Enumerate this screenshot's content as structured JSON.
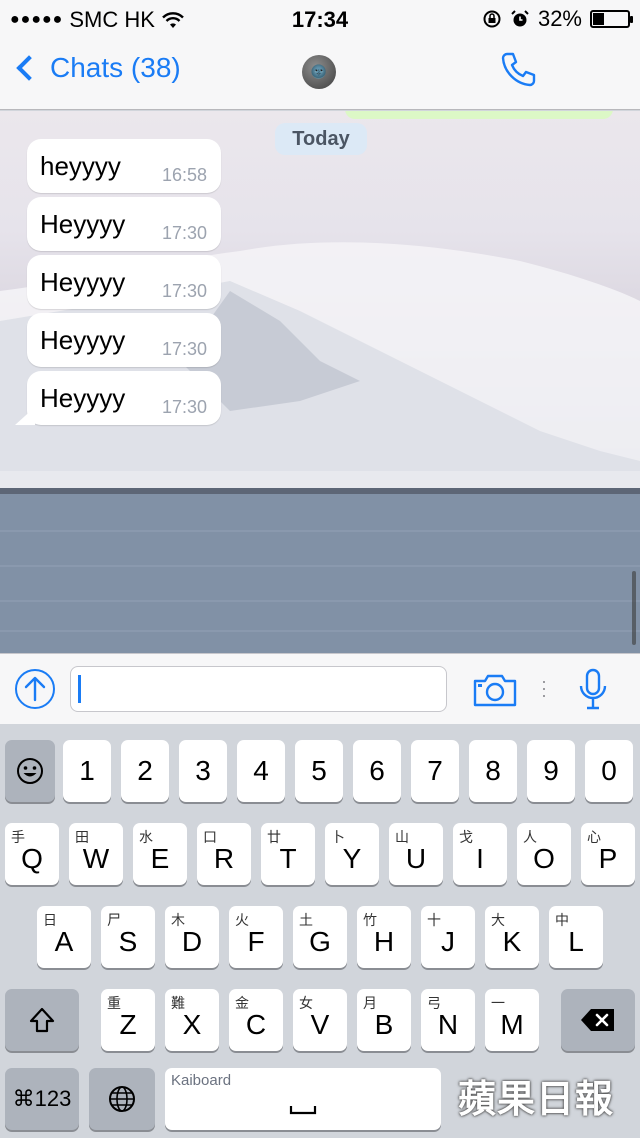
{
  "status_bar": {
    "signal": "●●●●●",
    "carrier": "SMC HK",
    "time": "17:34",
    "battery_percent": "32%",
    "battery_level": 0.32
  },
  "nav": {
    "back_label": "Chats (38)",
    "avatar_emoji": "🌚"
  },
  "chat": {
    "date_separator": "Today",
    "messages": [
      {
        "text": "heyyyy",
        "time": "16:58"
      },
      {
        "text": "Heyyyy",
        "time": "17:30"
      },
      {
        "text": "Heyyyy",
        "time": "17:30"
      },
      {
        "text": "Heyyyy",
        "time": "17:30"
      },
      {
        "text": "Heyyyy",
        "time": "17:30"
      }
    ]
  },
  "input": {
    "value": "",
    "placeholder": ""
  },
  "keyboard": {
    "number_row": [
      "1",
      "2",
      "3",
      "4",
      "5",
      "6",
      "7",
      "8",
      "9",
      "0"
    ],
    "row1": [
      {
        "sub": "手",
        "key": "Q"
      },
      {
        "sub": "田",
        "key": "W"
      },
      {
        "sub": "水",
        "key": "E"
      },
      {
        "sub": "口",
        "key": "R"
      },
      {
        "sub": "廿",
        "key": "T"
      },
      {
        "sub": "卜",
        "key": "Y"
      },
      {
        "sub": "山",
        "key": "U"
      },
      {
        "sub": "戈",
        "key": "I"
      },
      {
        "sub": "人",
        "key": "O"
      },
      {
        "sub": "心",
        "key": "P"
      }
    ],
    "row2": [
      {
        "sub": "日",
        "key": "A"
      },
      {
        "sub": "尸",
        "key": "S"
      },
      {
        "sub": "木",
        "key": "D"
      },
      {
        "sub": "火",
        "key": "F"
      },
      {
        "sub": "土",
        "key": "G"
      },
      {
        "sub": "竹",
        "key": "H"
      },
      {
        "sub": "十",
        "key": "J"
      },
      {
        "sub": "大",
        "key": "K"
      },
      {
        "sub": "中",
        "key": "L"
      }
    ],
    "row3": [
      {
        "sub": "重",
        "key": "Z"
      },
      {
        "sub": "難",
        "key": "X"
      },
      {
        "sub": "金",
        "key": "C"
      },
      {
        "sub": "女",
        "key": "V"
      },
      {
        "sub": "月",
        "key": "B"
      },
      {
        "sub": "弓",
        "key": "N"
      },
      {
        "sub": "一",
        "key": "M"
      }
    ],
    "cmd_label": "⌘123",
    "space_label": "Kaiboard"
  },
  "watermark": "蘋果日報",
  "colors": {
    "accent": "#1a7cf5",
    "outgoing_bubble": "#dcf8c6",
    "incoming_bubble": "#ffffff"
  }
}
